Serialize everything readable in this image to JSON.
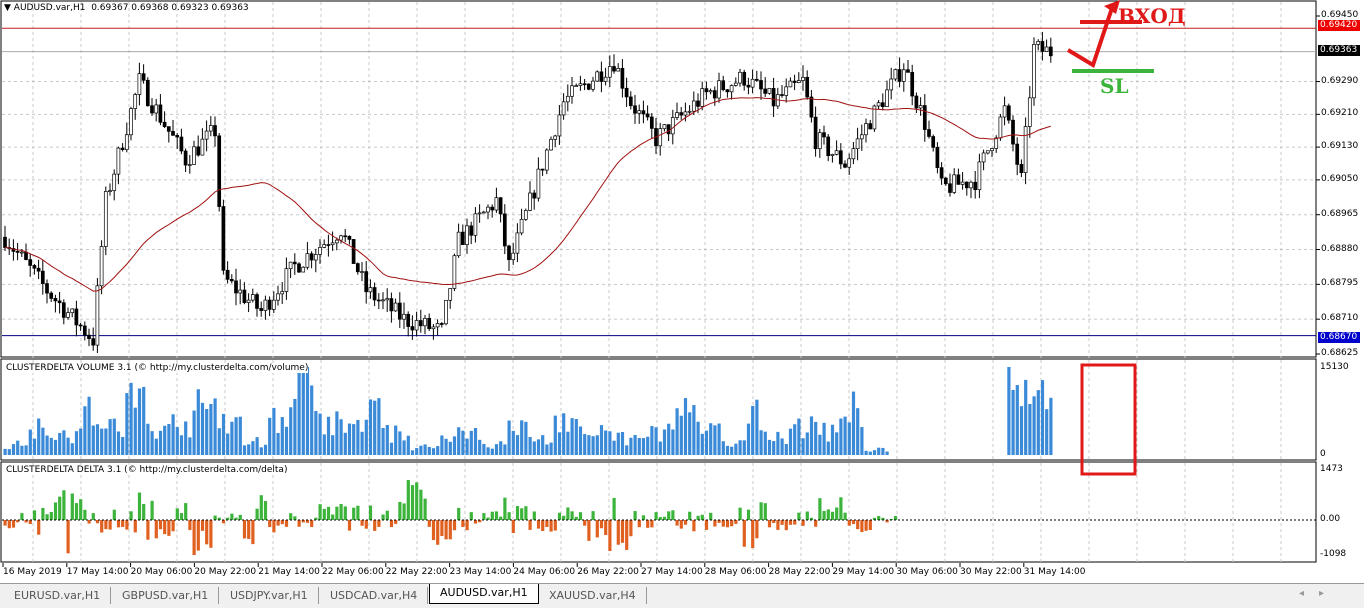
{
  "header": {
    "symbol": "AUDUSD.var,H1",
    "ohlc": "0.69367 0.69368 0.69323 0.69363"
  },
  "price_axis": {
    "ticks": [
      "0.69450",
      "0.69290",
      "0.69210",
      "0.69130",
      "0.69050",
      "0.68965",
      "0.68880",
      "0.68795",
      "0.68710",
      "0.68625"
    ],
    "tick_values": [
      0.6945,
      0.6929,
      0.6921,
      0.6913,
      0.6905,
      0.68965,
      0.6888,
      0.68795,
      0.6871,
      0.68625
    ],
    "range": [
      0.68625,
      0.6945
    ],
    "resistance": "0.69420",
    "resistance_value": 0.6942,
    "bid": "0.69363",
    "bid_value": 0.69363,
    "support": "0.68670",
    "support_value": 0.6867
  },
  "annotations": {
    "entry": "ВХОД",
    "stop": "SL"
  },
  "volume_indicator": {
    "title": "CLUSTERDELTA VOLUME 3.1 (© http://my.clusterdelta.com/volume)",
    "max": "15130",
    "min": "0",
    "max_value": 15130
  },
  "delta_indicator": {
    "title": "CLUSTERDELTA DELTA 3.1 (© http://my.clusterdelta.com/delta)",
    "max": "1473",
    "zero": "0.00",
    "min": "-1098",
    "max_value": 1473,
    "min_value": -1098
  },
  "time_axis": [
    "16 May 2019",
    "17 May 14:00",
    "20 May 06:00",
    "20 May 22:00",
    "21 May 14:00",
    "22 May 06:00",
    "22 May 22:00",
    "23 May 14:00",
    "24 May 06:00",
    "26 May 22:00",
    "27 May 14:00",
    "28 May 06:00",
    "28 May 22:00",
    "29 May 14:00",
    "30 May 06:00",
    "30 May 22:00",
    "31 May 14:00"
  ],
  "tabs": [
    {
      "label": "EURUSD.var,H1"
    },
    {
      "label": "GBPUSD.var,H1"
    },
    {
      "label": "USDJPY.var,H1"
    },
    {
      "label": "USDCAD.var,H4"
    },
    {
      "label": "AUDUSD.var,H1",
      "active": true
    },
    {
      "label": "XAUUSD.var,H4"
    }
  ],
  "chart_data": {
    "type": "candlestick",
    "bars": 250,
    "close_keypoints": [
      [
        0,
        0.6891
      ],
      [
        10,
        0.6878
      ],
      [
        21,
        0.6866
      ],
      [
        24,
        0.69
      ],
      [
        32,
        0.6929
      ],
      [
        43,
        0.691
      ],
      [
        50,
        0.6917
      ],
      [
        52,
        0.6881
      ],
      [
        61,
        0.6873
      ],
      [
        69,
        0.6884
      ],
      [
        80,
        0.6893
      ],
      [
        86,
        0.6878
      ],
      [
        95,
        0.6871
      ],
      [
        104,
        0.6868
      ],
      [
        108,
        0.689
      ],
      [
        117,
        0.69
      ],
      [
        120,
        0.6884
      ],
      [
        129,
        0.6912
      ],
      [
        133,
        0.6924
      ],
      [
        145,
        0.6934
      ],
      [
        149,
        0.6924
      ],
      [
        155,
        0.6915
      ],
      [
        167,
        0.6926
      ],
      [
        176,
        0.693
      ],
      [
        183,
        0.6924
      ],
      [
        190,
        0.6929
      ],
      [
        193,
        0.6915
      ],
      [
        200,
        0.6909
      ],
      [
        205,
        0.6918
      ],
      [
        214,
        0.6933
      ],
      [
        219,
        0.6919
      ],
      [
        223,
        0.6903
      ],
      [
        231,
        0.6905
      ],
      [
        238,
        0.6922
      ],
      [
        242,
        0.6905
      ],
      [
        245,
        0.6937
      ],
      [
        249,
        0.69363
      ]
    ],
    "volume_keypoints": [
      2000,
      5500,
      4000,
      8000,
      5000,
      10500,
      4500,
      6000,
      9000,
      5500,
      2500,
      7000,
      15130,
      6000,
      5000,
      9000,
      4000,
      1500,
      3000,
      4500,
      2000,
      5000,
      3000,
      6500,
      4000,
      3500,
      3000,
      4500,
      8500,
      4500,
      2000,
      8000,
      3500,
      5500,
      4500,
      8500,
      1000,
      0,
      0,
      0,
      0,
      0,
      12500,
      13000
    ],
    "delta_keypoints": [
      -200,
      400,
      1473,
      300,
      -300,
      700,
      -500,
      -900,
      200,
      600,
      -300,
      -200,
      400,
      -400,
      300,
      900,
      -600,
      -300,
      200,
      500,
      -400,
      300,
      -500,
      -800,
      200,
      -300,
      300,
      -200,
      700,
      -300,
      200,
      600,
      -300,
      100,
      0,
      0,
      0,
      0,
      0,
      0
    ],
    "ma_period": 40
  }
}
